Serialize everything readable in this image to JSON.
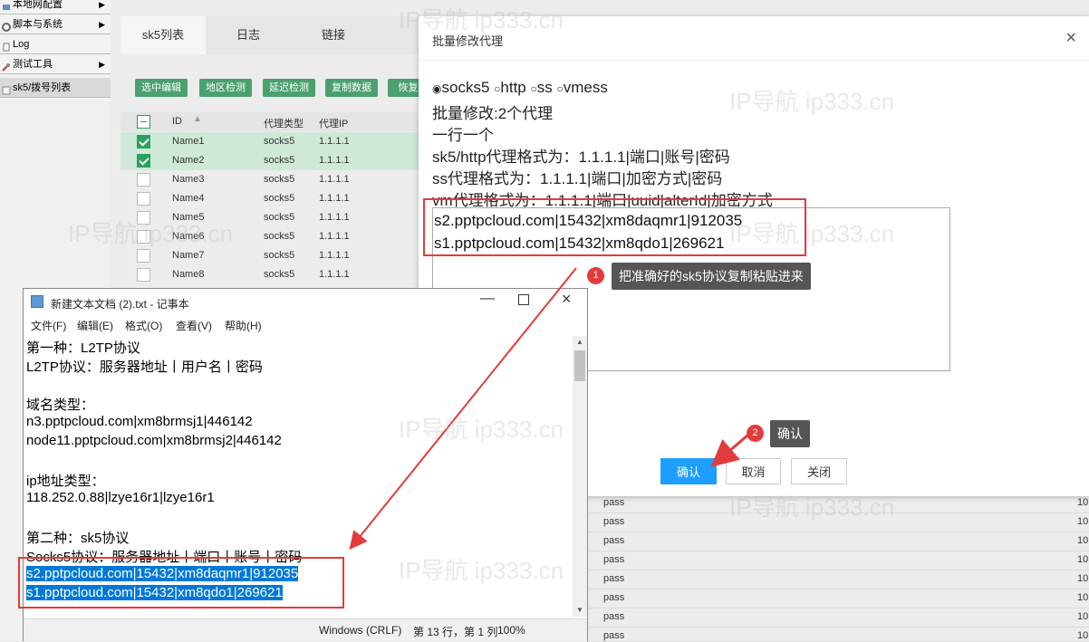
{
  "leftnav": {
    "items": [
      {
        "label": "本地网配置",
        "arrow": "▶"
      },
      {
        "label": "脚本与系统",
        "arrow": "▶"
      },
      {
        "label": "Log",
        "arrow": ""
      },
      {
        "label": "测试工具",
        "arrow": "▶"
      },
      {
        "label": "sk5/拨号列表",
        "arrow": ""
      }
    ]
  },
  "main": {
    "tabs": [
      "sk5列表",
      "日志",
      "链接"
    ],
    "toolbar": [
      "选中编辑",
      "地区检测",
      "延迟检测",
      "复制数据",
      "恢复"
    ],
    "columns": [
      "ID",
      "代理类型",
      "代理IP"
    ],
    "rows": [
      {
        "id": "Name1",
        "type": "socks5",
        "ip": "1.1.1.1",
        "checked": true
      },
      {
        "id": "Name2",
        "type": "socks5",
        "ip": "1.1.1.1",
        "checked": true
      },
      {
        "id": "Name3",
        "type": "socks5",
        "ip": "1.1.1.1",
        "checked": false
      },
      {
        "id": "Name4",
        "type": "socks5",
        "ip": "1.1.1.1",
        "checked": false
      },
      {
        "id": "Name5",
        "type": "socks5",
        "ip": "1.1.1.1",
        "checked": false
      },
      {
        "id": "Name6",
        "type": "socks5",
        "ip": "1.1.1.1",
        "checked": false
      },
      {
        "id": "Name7",
        "type": "socks5",
        "ip": "1.1.1.1",
        "checked": false
      },
      {
        "id": "Name8",
        "type": "socks5",
        "ip": "1.1.1.1",
        "checked": false
      }
    ],
    "pass_rows": [
      "pass",
      "pass",
      "pass",
      "pass",
      "pass",
      "pass",
      "pass",
      "pass"
    ],
    "pass_tail": "10"
  },
  "dialog": {
    "title": "批量修改代理",
    "close": "×",
    "radios": [
      "socks5",
      "http",
      "ss",
      "vmess"
    ],
    "radio_selected": "socks5",
    "count_text": "批量修改:2个代理",
    "per_line": "一行一个",
    "fmt_sk5": "sk5/http代理格式为：1.1.1.1|端口|账号|密码",
    "fmt_ss": "ss代理格式为：1.1.1.1|端口|加密方式|密码",
    "fmt_vm": "vm代理格式为：1.1.1.1|端口|uuid|alterId|加密方式",
    "textarea_lines": [
      "s2.pptpcloud.com|15432|xm8daqmr1|912035",
      "s1.pptpcloud.com|15432|xm8qdo1|269621"
    ],
    "btn_ok": "确认",
    "btn_cancel": "取消",
    "btn_close": "关闭"
  },
  "annotations": {
    "tip1_num": "1",
    "tip1_text": "把准确好的sk5协议复制粘贴进来",
    "tip2_num": "2",
    "tip2_text": "确认"
  },
  "notepad": {
    "title": "新建文本文档 (2).txt - 记事本",
    "menus": [
      "文件(F)",
      "编辑(E)",
      "格式(O)",
      "查看(V)",
      "帮助(H)"
    ],
    "lines": [
      "第一种：L2TP协议",
      "L2TP协议：服务器地址丨用户名丨密码",
      "",
      "域名类型：",
      "n3.pptpcloud.com|xm8brmsj1|446142",
      "node11.pptpcloud.com|xm8brmsj2|446142",
      "",
      "ip地址类型：",
      "118.252.0.88|lzye16r1|lzye16r1",
      "",
      "第二种：sk5协议",
      "Socks5协议：服务器地址丨端口丨账号丨密码"
    ],
    "selected_lines": [
      "s2.pptpcloud.com|15432|xm8daqmr1|912035",
      "s1.pptpcloud.com|15432|xm8qdo1|269621"
    ],
    "status_encoding": "Windows (CRLF)",
    "status_pos": "第 13 行，第 1 列",
    "status_zoom": "100%"
  },
  "watermark": "IP导航 ip333.cn",
  "colors": {
    "accent_green": "#4aa16e",
    "primary_blue": "#1e9fff",
    "annotation_red": "#e23b3b",
    "selection_blue": "#0078d7"
  }
}
